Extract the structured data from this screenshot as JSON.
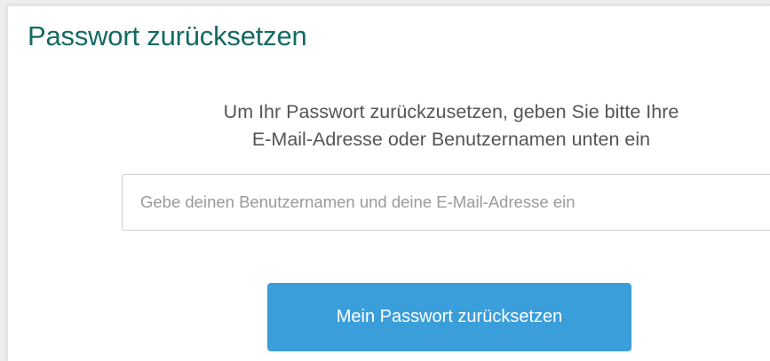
{
  "page": {
    "title": "Passwort zurücksetzen"
  },
  "form": {
    "instructions_line1": "Um Ihr Passwort zurückzusetzen, geben Sie bitte Ihre",
    "instructions_line2": "E-Mail-Adresse oder Benutzernamen unten ein",
    "input": {
      "value": "",
      "placeholder": "Gebe deinen Benutzernamen und deine E-Mail-Adresse ein"
    },
    "submit_label": "Mein Passwort zurücksetzen"
  },
  "colors": {
    "title": "#136a64",
    "button": "#3a9edb",
    "text": "#555555",
    "background": "#ffffff"
  }
}
